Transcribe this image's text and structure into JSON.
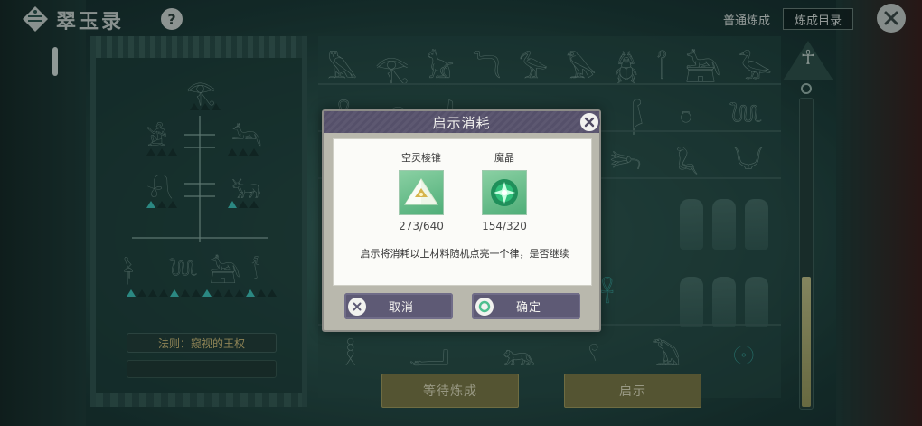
{
  "header": {
    "title": "翠玉录",
    "help_label": "?",
    "mode_label": "普通炼成",
    "catalog_label": "炼成目录"
  },
  "left_panel": {
    "rule_label": "法则：窥视的王权"
  },
  "bottom": {
    "wait_label": "等待炼成",
    "reveal_label": "启示"
  },
  "gauge": {
    "level": 0.42
  },
  "dialog": {
    "title": "启示消耗",
    "materials": [
      {
        "name": "空灵棱锥",
        "count": "273/640",
        "icon": "crystal-pyramid-icon"
      },
      {
        "name": "魔晶",
        "count": "154/320",
        "icon": "magic-crystal-orb-icon"
      }
    ],
    "notice": "启示将消耗以上材料随机点亮一个律，是否继续",
    "cancel_label": "取消",
    "confirm_label": "确定"
  },
  "colors": {
    "background": "#2b534d",
    "dialog_header": "#5d5871",
    "accent_gold": "#7f7a45",
    "lit_marker": "#3fc9c0"
  }
}
